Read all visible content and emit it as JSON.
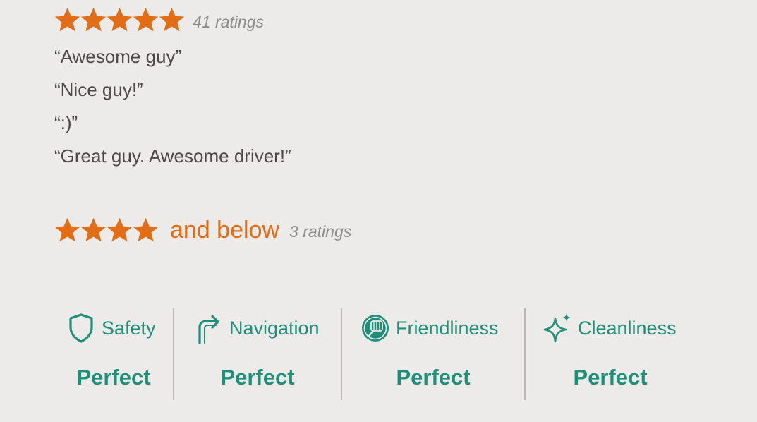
{
  "five_star": {
    "stars": 5,
    "count_text": "41 ratings",
    "comments": [
      "“Awesome guy”",
      "“Nice guy!”",
      "“:)”",
      "“Great guy. Awesome driver!”"
    ]
  },
  "four_and_below": {
    "stars": 4,
    "label": "and below",
    "count_text": "3 ratings"
  },
  "metrics": [
    {
      "label": "Safety",
      "value": "Perfect",
      "icon": "shield-icon"
    },
    {
      "label": "Navigation",
      "value": "Perfect",
      "icon": "turn-arrow-icon"
    },
    {
      "label": "Friendliness",
      "value": "Perfect",
      "icon": "fist-bump-icon"
    },
    {
      "label": "Cleanliness",
      "value": "Perfect",
      "icon": "sparkle-icon"
    }
  ],
  "colors": {
    "star": "#e36d14",
    "accent": "#1f8f7a",
    "count": "#8c8c8c",
    "comment_text": "#4d4946",
    "background": "#ecebe9",
    "divider": "#bdb7b2"
  }
}
